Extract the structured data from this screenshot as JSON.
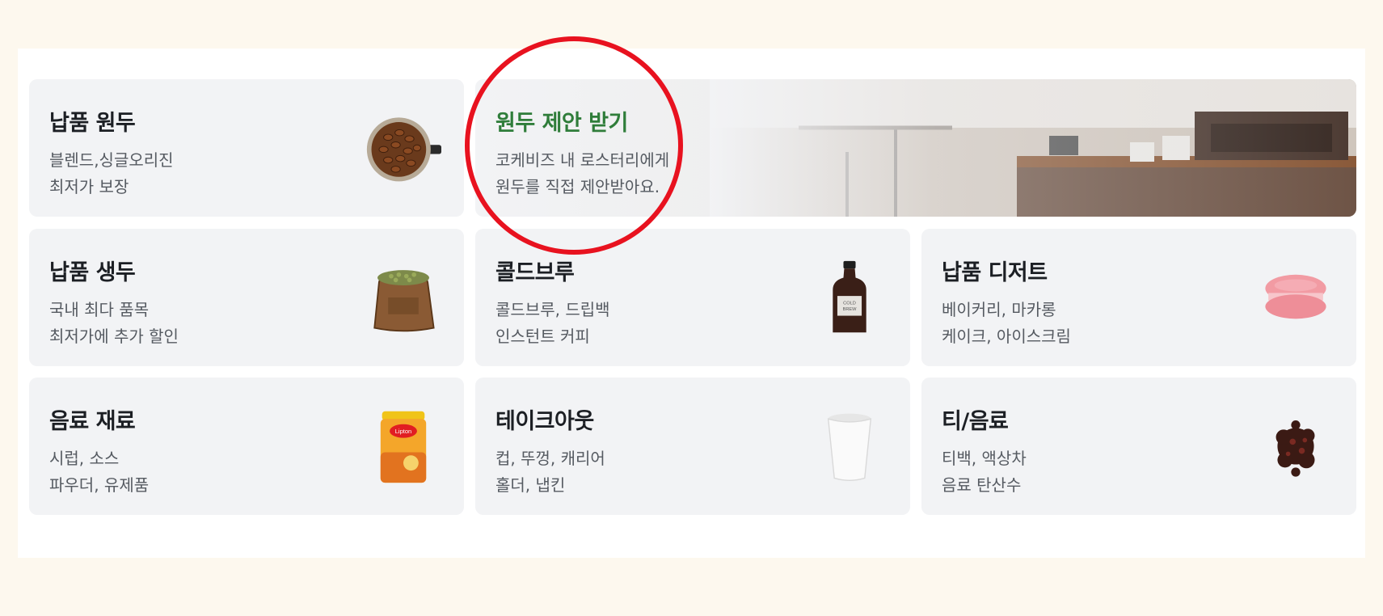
{
  "categories": [
    {
      "key": "beans",
      "title": "납품 원두",
      "line1": "블렌드,싱글오리진",
      "line2": "최저가 보장",
      "icon": "roasted-beans-portafilter"
    },
    {
      "key": "proposal",
      "title": "원두 제안 받기",
      "line1": "코케비즈 내 로스터리에게",
      "line2": "원두를 직접 제안받아요.",
      "icon": "cafe-counter-photo",
      "accent": "#2f7d3a"
    },
    {
      "key": "green",
      "title": "납품 생두",
      "line1": "국내 최다 품목",
      "line2": "최저가에 추가 할인",
      "icon": "green-bean-sack"
    },
    {
      "key": "coldbrew",
      "title": "콜드브루",
      "line1": "콜드브루, 드립백",
      "line2": "인스턴트 커피",
      "icon": "cold-brew-bottle",
      "bottle_label": "COLD BREW"
    },
    {
      "key": "dessert",
      "title": "납품 디저트",
      "line1": "베이커리, 마카롱",
      "line2": "케이크, 아이스크림",
      "icon": "macaron"
    },
    {
      "key": "drink",
      "title": "음료 재료",
      "line1": "시럽, 소스",
      "line2": "파우더, 유제품",
      "icon": "powder-can",
      "brand": "Lipton"
    },
    {
      "key": "takeout",
      "title": "테이크아웃",
      "line1": "컵, 뚜껑, 캐리어",
      "line2": "홀더, 냅킨",
      "icon": "paper-cup"
    },
    {
      "key": "tea",
      "title": "티/음료",
      "line1": "티백, 액상차",
      "line2": "음료 탄산수",
      "icon": "loose-leaf-tea"
    }
  ],
  "highlight_color": "#e8121f"
}
